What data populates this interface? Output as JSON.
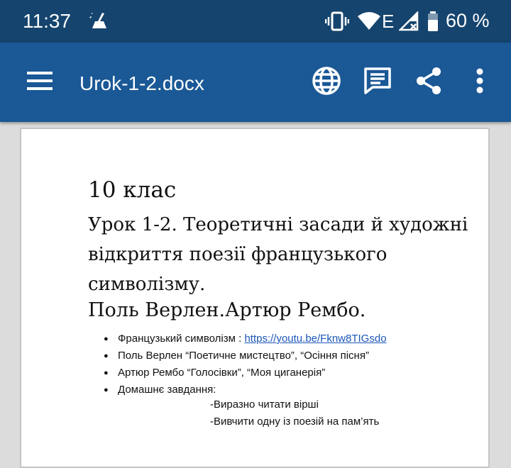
{
  "status_bar": {
    "time": "11:37",
    "battery": "60 %",
    "network_label": "E"
  },
  "app_bar": {
    "title": "Urok-1-2.docx",
    "icons": [
      "menu-icon",
      "globe-icon",
      "comments-icon",
      "share-icon",
      "more-vert-icon"
    ],
    "background": "#1a5896"
  },
  "document": {
    "class_heading": "10 клас",
    "lesson_title": "Урок 1-2.  Теоретичні засади й художні відкриття поезії французького символізму.",
    "authors": "Поль Верлен.Артюр Рембо.",
    "bullets": {
      "item1_text": "Французький символізм : ",
      "item1_link": "https://youtu.be/Fknw8TIGsdo",
      "item2": "Поль Верлен “Поетичне мистецтво”, “Осіння пісня”",
      "item3": "Артюр Рембо “Голосівки”, “Моя циганерія”",
      "item4": "Домашнє завдання:"
    },
    "homework": [
      "-Виразно читати вірші",
      "-Вивчити одну із поезій на пам’ять"
    ],
    "link_color": "#1a56b8"
  }
}
